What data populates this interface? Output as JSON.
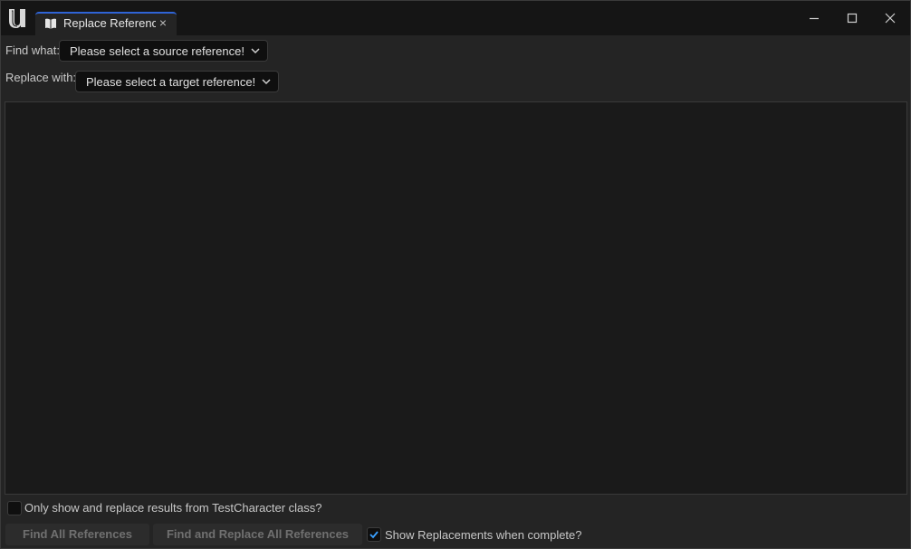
{
  "window": {
    "tab_title": "Replace Referenc",
    "tab_close": "×",
    "icons": {
      "logo": "unreal-logo",
      "tab": "book-icon",
      "minimize": "minimize-icon",
      "maximize": "maximize-icon",
      "close": "close-icon"
    }
  },
  "find_what": {
    "label": "Find what:",
    "value": "Please select a source reference!"
  },
  "replace_with": {
    "label": "Replace with:",
    "value": "Please select a target reference!"
  },
  "options": {
    "only_class_label": "Only show and replace results from TestCharacter class?",
    "only_class_checked": false,
    "show_replacements_label": "Show Replacements when complete?",
    "show_replacements_checked": true
  },
  "buttons": {
    "find_all": "Find All References",
    "find_replace_all": "Find and Replace All References"
  },
  "colors": {
    "accent": "#2f64d6",
    "check": "#3aa0ff"
  }
}
